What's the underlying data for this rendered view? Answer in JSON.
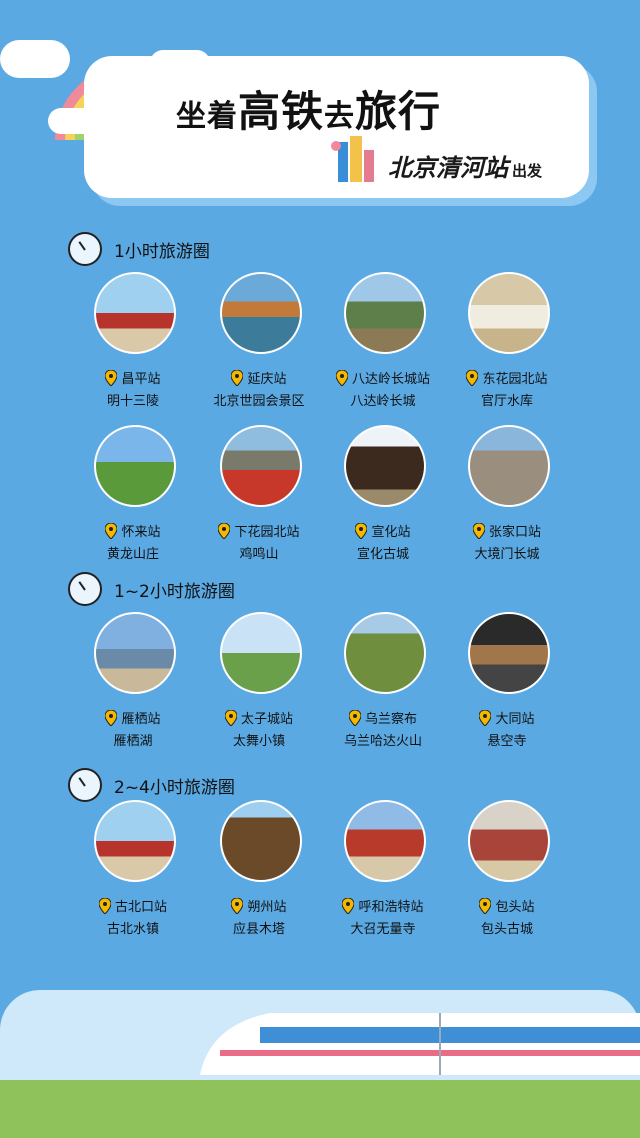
{
  "header": {
    "title_a": "坐着",
    "title_b": "高铁",
    "title_c": "去",
    "title_d": "旅行",
    "subtitle": "北京清河站",
    "subtitle_suffix": "出发"
  },
  "sections": [
    {
      "label": "1小时旅游圈",
      "items": [
        {
          "station": "昌平站",
          "place": "明十三陵",
          "photo": "tomb-gate"
        },
        {
          "station": "延庆站",
          "place": "北京世园会景区",
          "photo": "expo-pavilion"
        },
        {
          "station": "八达岭长城站",
          "place": "八达岭长城",
          "photo": "great-wall"
        },
        {
          "station": "东花园北站",
          "place": "官厅水库",
          "photo": "reservoir"
        },
        {
          "station": "怀来站",
          "place": "黄龙山庄",
          "photo": "green-hills"
        },
        {
          "station": "下花园北站",
          "place": "鸡鸣山",
          "photo": "red-mountain"
        },
        {
          "station": "宣化站",
          "place": "宣化古城",
          "photo": "drum-tower"
        },
        {
          "station": "张家口站",
          "place": "大境门长城",
          "photo": "city-gate"
        }
      ]
    },
    {
      "label": "1~2小时旅游圈",
      "items": [
        {
          "station": "雁栖站",
          "place": "雁栖湖",
          "photo": "lake"
        },
        {
          "station": "太子城站",
          "place": "太舞小镇",
          "photo": "cable-car"
        },
        {
          "station": "乌兰察布",
          "place": "乌兰哈达火山",
          "photo": "volcano"
        },
        {
          "station": "大同站",
          "place": "悬空寺",
          "photo": "hanging-temple"
        }
      ]
    },
    {
      "label": "2~4小时旅游圈",
      "items": [
        {
          "station": "古北口站",
          "place": "古北水镇",
          "photo": "tomb-gate"
        },
        {
          "station": "朔州站",
          "place": "应县木塔",
          "photo": "pagoda"
        },
        {
          "station": "呼和浩特站",
          "place": "大召无量寺",
          "photo": "temple"
        },
        {
          "station": "包头站",
          "place": "包头古城",
          "photo": "old-gate"
        }
      ]
    }
  ],
  "colors": {
    "sky": "#5aa9e3",
    "card": "#ffffff",
    "pin": "#f5b800",
    "ground": "#8fc25a"
  }
}
